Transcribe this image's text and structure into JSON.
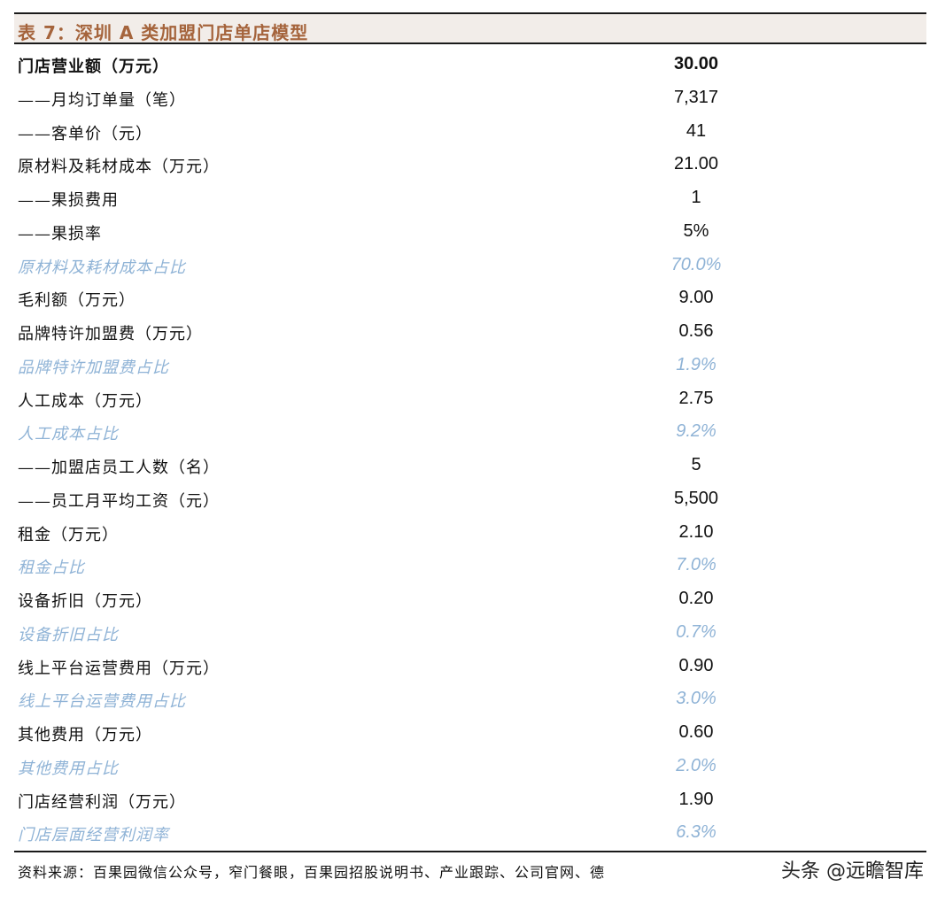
{
  "title": "表 7：深圳 A 类加盟门店单店模型",
  "rows": [
    {
      "label": "门店营业额（万元）",
      "value": "30.00",
      "style": "bold"
    },
    {
      "label": "——月均订单量（笔）",
      "value": "7,317",
      "style": "normal"
    },
    {
      "label": "——客单价（元）",
      "value": "41",
      "style": "normal"
    },
    {
      "label": "原材料及耗材成本（万元）",
      "value": "21.00",
      "style": "normal"
    },
    {
      "label": "——果损费用",
      "value": "1",
      "style": "normal"
    },
    {
      "label": "——果损率",
      "value": "5%",
      "style": "normal"
    },
    {
      "label": "原材料及耗材成本占比",
      "value": "70.0%",
      "style": "italic"
    },
    {
      "label": "毛利额（万元）",
      "value": "9.00",
      "style": "normal"
    },
    {
      "label": "品牌特许加盟费（万元）",
      "value": "0.56",
      "style": "normal"
    },
    {
      "label": "品牌特许加盟费占比",
      "value": "1.9%",
      "style": "italic"
    },
    {
      "label": "人工成本（万元）",
      "value": "2.75",
      "style": "normal"
    },
    {
      "label": "人工成本占比",
      "value": "9.2%",
      "style": "italic"
    },
    {
      "label": "——加盟店员工人数（名）",
      "value": "5",
      "style": "normal"
    },
    {
      "label": "——员工月平均工资（元）",
      "value": "5,500",
      "style": "normal"
    },
    {
      "label": "租金（万元）",
      "value": "2.10",
      "style": "normal"
    },
    {
      "label": "租金占比",
      "value": "7.0%",
      "style": "italic"
    },
    {
      "label": "设备折旧（万元）",
      "value": "0.20",
      "style": "normal"
    },
    {
      "label": "设备折旧占比",
      "value": "0.7%",
      "style": "italic"
    },
    {
      "label": "线上平台运营费用（万元）",
      "value": "0.90",
      "style": "normal"
    },
    {
      "label": "线上平台运营费用占比",
      "value": "3.0%",
      "style": "italic"
    },
    {
      "label": "其他费用（万元）",
      "value": "0.60",
      "style": "normal"
    },
    {
      "label": "其他费用占比",
      "value": "2.0%",
      "style": "italic"
    },
    {
      "label": "门店经营利润（万元）",
      "value": "1.90",
      "style": "normal"
    },
    {
      "label": "门店层面经营利润率",
      "value": "6.3%",
      "style": "italic"
    }
  ],
  "source": "资料来源：百果园微信公众号，窄门餐眼，百果园招股说明书、产业跟踪、公司官网、德",
  "watermark": "头条 @远瞻智库",
  "colors": {
    "title_text": "#a5643c",
    "title_bg": "#f2ede9",
    "italic_text": "#8fb3d6",
    "rule": "#1a1a1a"
  }
}
